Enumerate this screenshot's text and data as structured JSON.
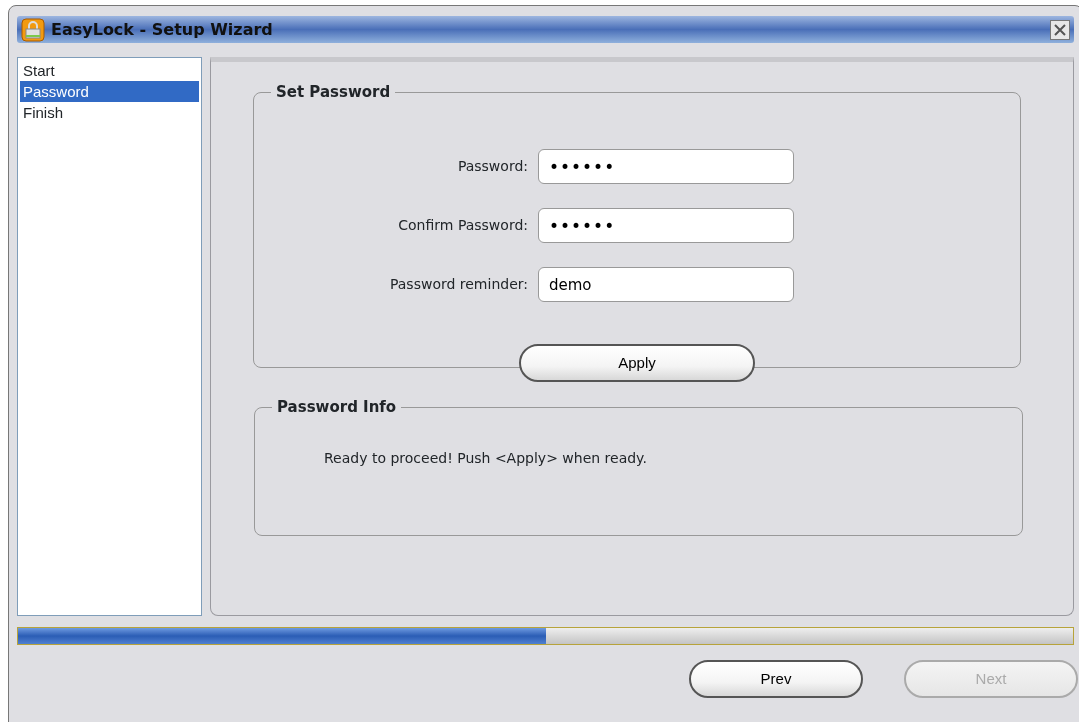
{
  "window": {
    "title": "EasyLock - Setup Wizard"
  },
  "steps": [
    {
      "label": "Start",
      "selected": false
    },
    {
      "label": "Password",
      "selected": true
    },
    {
      "label": "Finish",
      "selected": false
    }
  ],
  "set_password": {
    "title": "Set Password",
    "fields": [
      {
        "label": "Password:",
        "value": "••••••",
        "kind": "secret"
      },
      {
        "label": "Confirm Password:",
        "value": "••••••",
        "kind": "secret"
      },
      {
        "label": "Password reminder:",
        "value": "demo",
        "kind": "text"
      }
    ],
    "apply_button": {
      "label": "Apply",
      "disabled": false
    }
  },
  "password_info": {
    "title": "Password Info",
    "message": "Ready to proceed! Push <Apply> when ready."
  },
  "progress": {
    "level": 0.5
  },
  "buttons": [
    {
      "label": "Prev",
      "disabled": false
    },
    {
      "label": "Next",
      "disabled": true
    }
  ]
}
